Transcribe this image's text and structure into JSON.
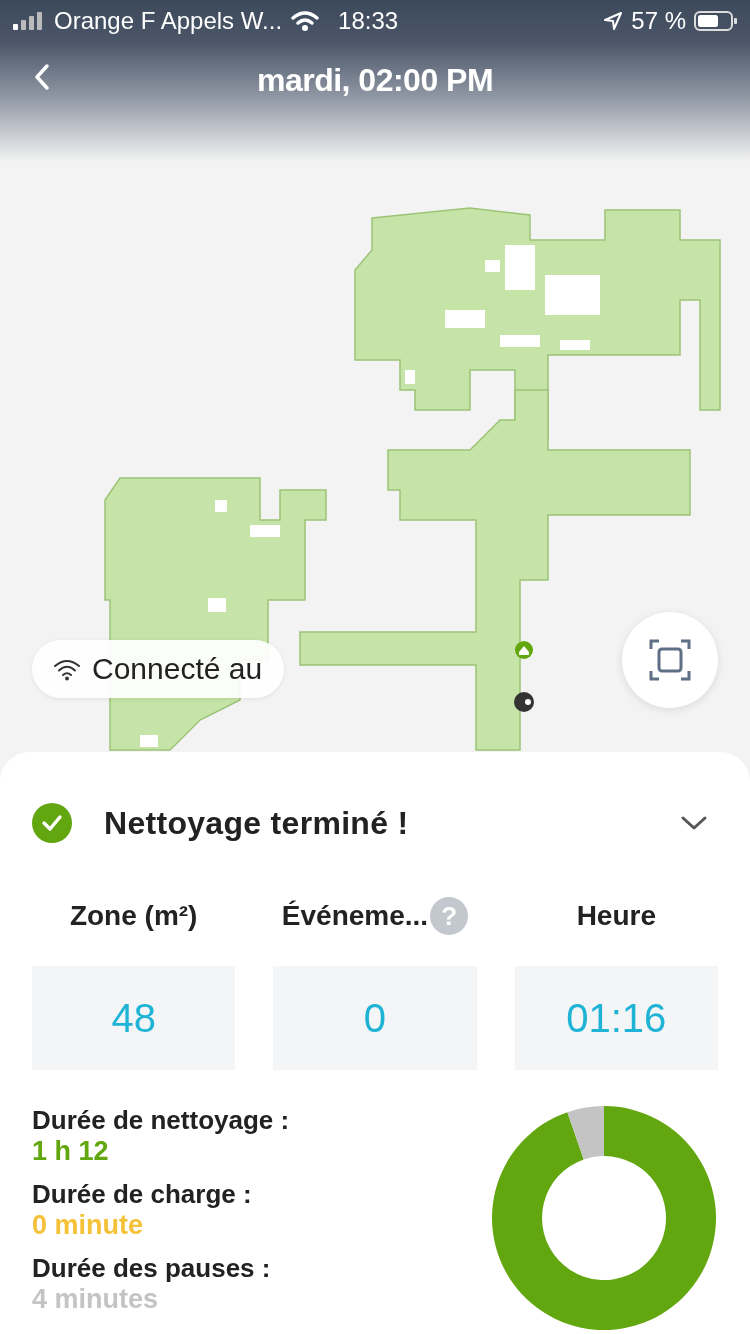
{
  "status_bar": {
    "carrier": "Orange F Appels W...",
    "time": "18:33",
    "battery": "57 %"
  },
  "header": {
    "title": "mardi, 02:00 PM"
  },
  "map": {
    "connection_chip": "Connecté au"
  },
  "summary": {
    "title": "Nettoyage terminé !",
    "expanded": false,
    "stats": [
      {
        "label": "Zone (m²)",
        "value": "48"
      },
      {
        "label": "Événeme...",
        "value": "0",
        "help": "?"
      },
      {
        "label": "Heure",
        "value": "01:16"
      }
    ],
    "durations": [
      {
        "label": "Durée de nettoyage :",
        "value": "1 h 12",
        "color": "#62a70f"
      },
      {
        "label": "Durée de charge :",
        "value": "0 minute",
        "color": "#f5c138"
      },
      {
        "label": "Durée des pauses :",
        "value": "4 minutes",
        "color": "#c4c4c4"
      }
    ]
  }
}
